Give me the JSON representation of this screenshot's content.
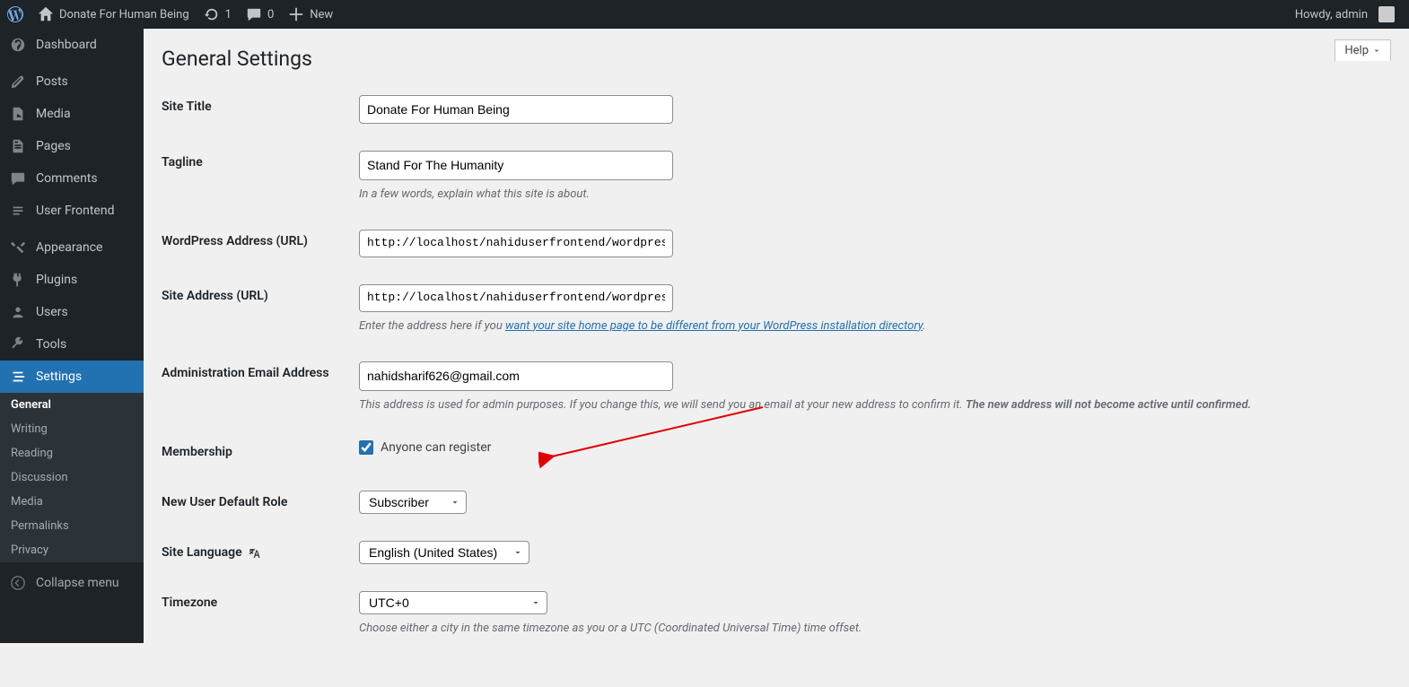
{
  "topbar": {
    "site": "Donate For Human Being",
    "updates": "1",
    "comments": "0",
    "new": "New",
    "howdy": "Howdy, admin"
  },
  "sidebar": {
    "dashboard": "Dashboard",
    "posts": "Posts",
    "media": "Media",
    "pages": "Pages",
    "comments": "Comments",
    "user_frontend": "User Frontend",
    "appearance": "Appearance",
    "plugins": "Plugins",
    "users": "Users",
    "tools": "Tools",
    "settings": "Settings",
    "sub": {
      "general": "General",
      "writing": "Writing",
      "reading": "Reading",
      "discussion": "Discussion",
      "media": "Media",
      "permalinks": "Permalinks",
      "privacy": "Privacy"
    },
    "collapse": "Collapse menu"
  },
  "help": {
    "label": "Help"
  },
  "page": {
    "title": "General Settings"
  },
  "form": {
    "site_title": {
      "label": "Site Title",
      "value": "Donate For Human Being"
    },
    "tagline": {
      "label": "Tagline",
      "value": "Stand For The Humanity",
      "desc": "In a few words, explain what this site is about."
    },
    "wp_address": {
      "label": "WordPress Address (URL)",
      "value": "http://localhost/nahiduserfrontend/wordpres"
    },
    "site_address": {
      "label": "Site Address (URL)",
      "value": "http://localhost/nahiduserfrontend/wordpres",
      "desc_pre": "Enter the address here if you ",
      "desc_link": "want your site home page to be different from your WordPress installation directory",
      "desc_post": "."
    },
    "admin_email": {
      "label": "Administration Email Address",
      "value": "nahidsharif626@gmail.com",
      "desc_pre": "This address is used for admin purposes. If you change this, we will send you an email at your new address to confirm it. ",
      "desc_bold": "The new address will not become active until confirmed."
    },
    "membership": {
      "label": "Membership",
      "cb_label": "Anyone can register"
    },
    "default_role": {
      "label": "New User Default Role",
      "value": "Subscriber"
    },
    "language": {
      "label": "Site Language",
      "value": "English (United States)"
    },
    "timezone": {
      "label": "Timezone",
      "value": "UTC+0",
      "desc": "Choose either a city in the same timezone as you or a UTC (Coordinated Universal Time) time offset."
    }
  }
}
